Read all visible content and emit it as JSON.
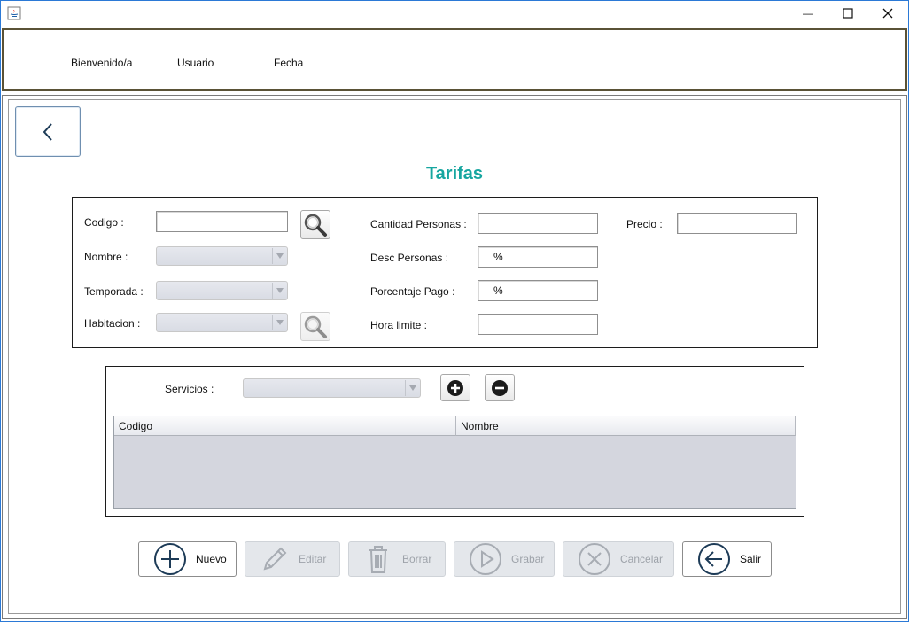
{
  "window": {
    "minimize_glyph": "—",
    "maximize_glyph": "☐",
    "close_glyph": "✕"
  },
  "header": {
    "welcome_label": "Bienvenido/a",
    "user_label": "Usuario",
    "date_label": "Fecha"
  },
  "page": {
    "title": "Tarifas",
    "title_color": "#17a6a0"
  },
  "form": {
    "codigo_label": "Codigo :",
    "codigo_value": "",
    "nombre_label": "Nombre :",
    "temporada_label": "Temporada :",
    "habitacion_label": "Habitacion :",
    "cantidad_personas_label": "Cantidad Personas :",
    "cantidad_personas_value": "",
    "desc_personas_label": "Desc Personas :",
    "desc_personas_value": "%",
    "porcentaje_pago_label": "Porcentaje Pago :",
    "porcentaje_pago_value": "%",
    "hora_limite_label": "Hora limite :",
    "hora_limite_value": "",
    "precio_label": "Precio :",
    "precio_value": ""
  },
  "services": {
    "label": "Servicios :",
    "table_columns": [
      "Codigo",
      "Nombre"
    ],
    "rows": []
  },
  "actions": {
    "nuevo": "Nuevo",
    "editar": "Editar",
    "borrar": "Borrar",
    "grabar": "Grabar",
    "cancelar": "Cancelar",
    "salir": "Salir"
  }
}
